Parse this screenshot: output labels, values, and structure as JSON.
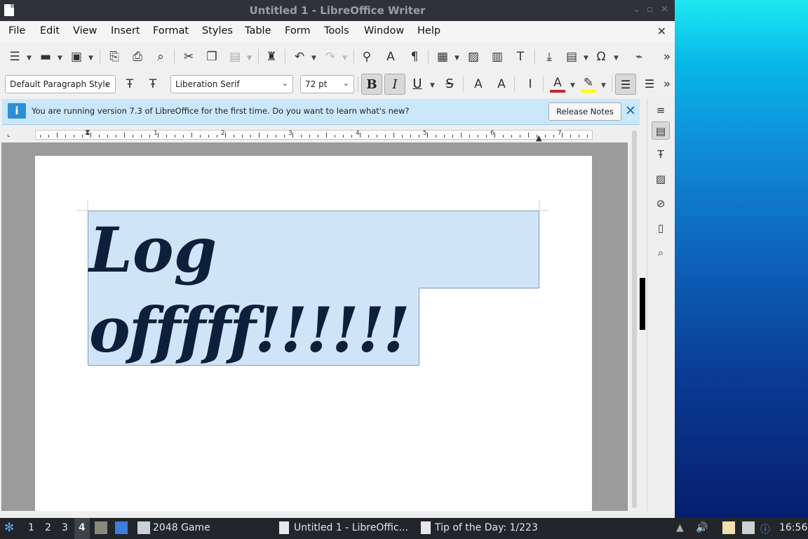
{
  "window": {
    "title": "Untitled 1 - LibreOffice Writer",
    "controls": [
      "⌄",
      "▫",
      "✕"
    ]
  },
  "menu": [
    "File",
    "Edit",
    "View",
    "Insert",
    "Format",
    "Styles",
    "Table",
    "Form",
    "Tools",
    "Window",
    "Help"
  ],
  "formatting": {
    "paragraph_style": "Default Paragraph Style",
    "font_name": "Liberation Serif",
    "font_size": "72 pt",
    "bold_label": "B",
    "italic_label": "I",
    "underline_label": "U",
    "strike_label": "S",
    "font_color": "#c0272d",
    "highlight_color": "#ffff00"
  },
  "infobar": {
    "message": "You are running version 7.3 of LibreOffice for the first time. Do you want to learn what's new?",
    "button": "Release Notes"
  },
  "ruler": {
    "numbers": [
      "1",
      "2",
      "3",
      "4",
      "5",
      "6",
      "7"
    ]
  },
  "document": {
    "line1": "Log",
    "line2": "offfff!!!!!!"
  },
  "taskbar": {
    "workspaces": [
      "1",
      "2",
      "3",
      "4"
    ],
    "active_workspace": "4",
    "tasks": [
      "2048 Game",
      "Untitled 1 - LibreOffic...",
      "Tip of the Day: 1/223"
    ],
    "clock": "16:56"
  }
}
